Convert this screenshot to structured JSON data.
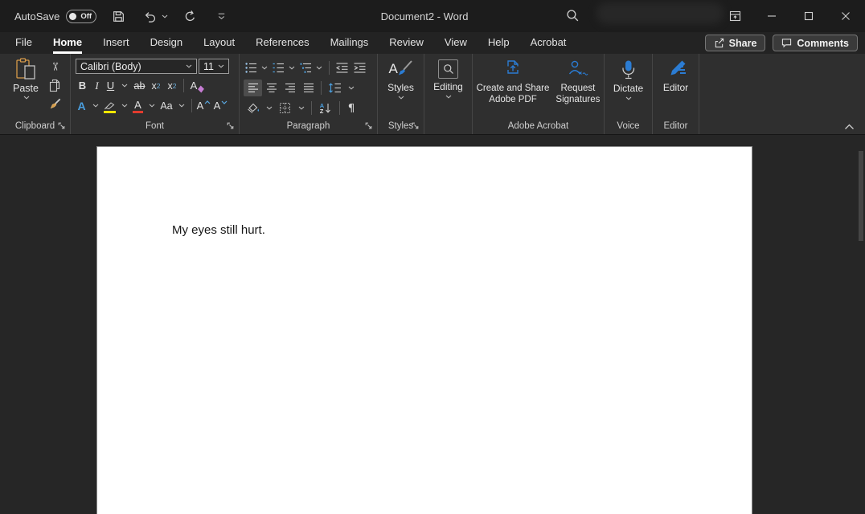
{
  "colors": {
    "accent_blue": "#2b7cd3",
    "icon_blue": "#4a9ede",
    "highlight_yellow": "#f3e600",
    "font_color_red": "#e23b2e",
    "clipboard_orange": "#d79b4a",
    "eraser_purple": "#c77dd4"
  },
  "titlebar": {
    "autosave_label": "AutoSave",
    "autosave_state": "Off",
    "document_title": "Document2 - Word"
  },
  "tabs": {
    "items": [
      "File",
      "Home",
      "Insert",
      "Design",
      "Layout",
      "References",
      "Mailings",
      "Review",
      "View",
      "Help",
      "Acrobat"
    ],
    "active": "Home",
    "share_label": "Share",
    "comments_label": "Comments"
  },
  "ribbon": {
    "clipboard": {
      "paste_label": "Paste",
      "group_label": "Clipboard"
    },
    "font": {
      "font_name": "Calibri (Body)",
      "font_size": "11",
      "group_label": "Font",
      "bold": "B",
      "italic": "I",
      "underline": "U",
      "strikethrough": "ab",
      "sub_base": "x",
      "sub_digit": "2",
      "sup_base": "x",
      "sup_digit": "2",
      "clear_format": "A",
      "text_effects": "A",
      "font_color": "A",
      "change_case": "Aa",
      "grow_font": "A",
      "shrink_font": "A"
    },
    "paragraph": {
      "group_label": "Paragraph",
      "sort_a": "A",
      "sort_z": "Z",
      "pilcrow": "¶"
    },
    "styles": {
      "button_label": "Styles",
      "group_label": "Styles",
      "icon_letter": "A"
    },
    "editing": {
      "button_label": "Editing"
    },
    "acrobat": {
      "create_line1": "Create and Share",
      "create_line2": "Adobe PDF",
      "request_line1": "Request",
      "request_line2": "Signatures",
      "group_label": "Adobe Acrobat"
    },
    "voice": {
      "button_label": "Dictate",
      "group_label": "Voice"
    },
    "editor": {
      "button_label": "Editor",
      "group_label": "Editor"
    }
  },
  "document": {
    "body_text": "My eyes still hurt."
  }
}
